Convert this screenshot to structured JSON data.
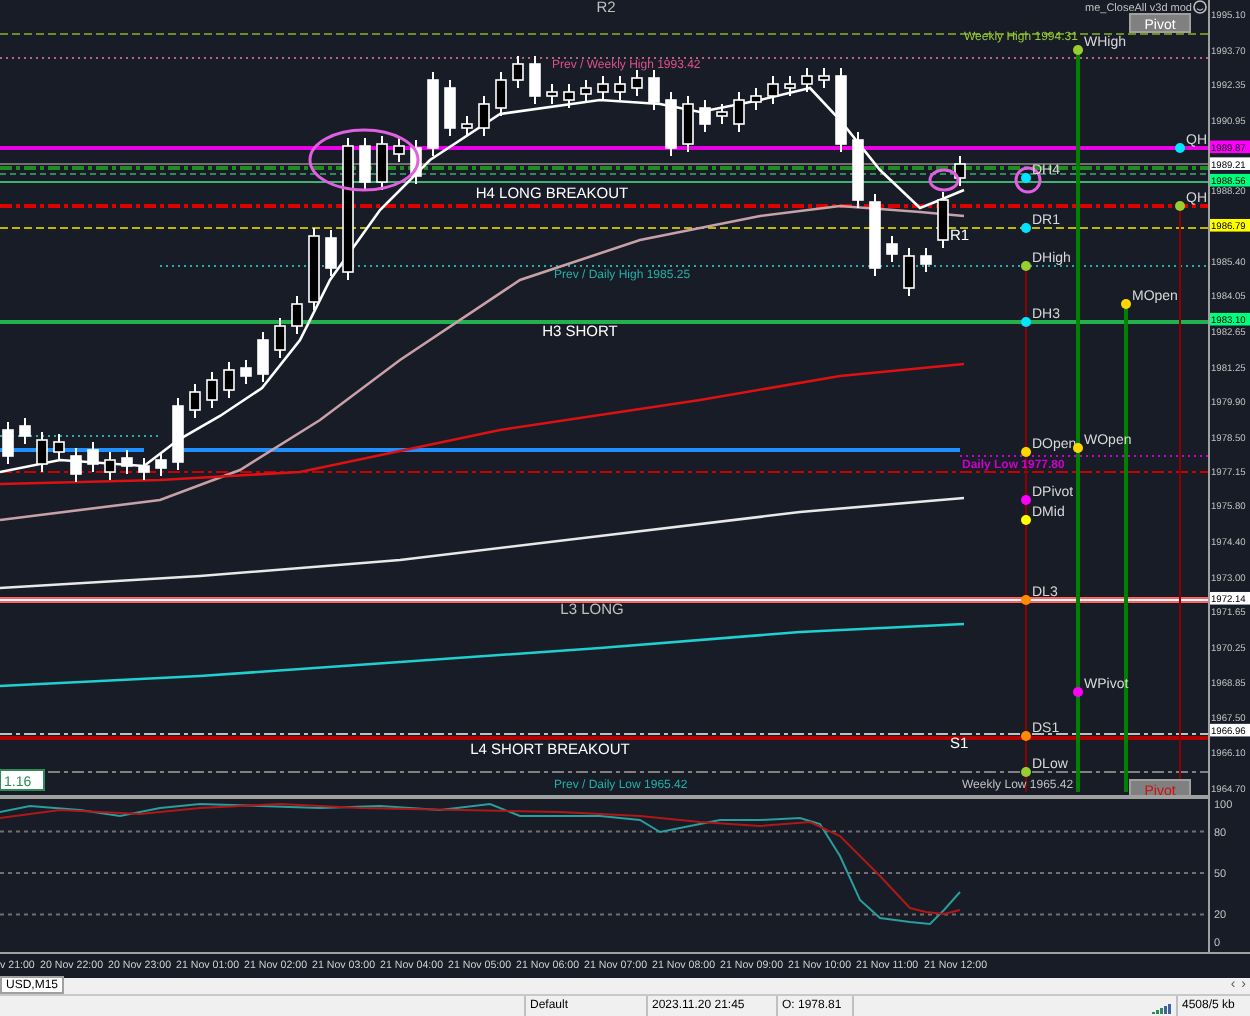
{
  "chart": {
    "expert_label": "me_CloseAll v3d  mod",
    "pivot_buttons": [
      "Pivot",
      "Pivot"
    ],
    "price_ticks": [
      "1995.10",
      "1993.70",
      "1992.35",
      "1990.95",
      "1988.20",
      "1985.40",
      "1984.05",
      "1982.65",
      "1981.25",
      "1979.90",
      "1978.50",
      "1977.15",
      "1975.80",
      "1974.40",
      "1973.00",
      "1971.65",
      "1970.25",
      "1968.85",
      "1967.50",
      "1966.10",
      "1964.70"
    ],
    "price_markers": [
      {
        "label": "1989.87",
        "color": "#ff00ff"
      },
      {
        "label": "1989.21",
        "color": "#ffffff"
      },
      {
        "label": "1988.56",
        "color": "#00ff7f"
      },
      {
        "label": "1986.79",
        "color": "#ffff00"
      },
      {
        "label": "1983.10",
        "color": "#00ff7f"
      },
      {
        "label": "1972.14",
        "color": "#ffffff"
      },
      {
        "label": "1966.96",
        "color": "#ffffff"
      }
    ],
    "level_labels": [
      {
        "text": "R2",
        "color": "#c0c0c0"
      },
      {
        "text": "Weekly High 1994.31",
        "color": "#9acd32"
      },
      {
        "text": "Prev / Weekly High 1993.42",
        "color": "#e0508a"
      },
      {
        "text": "H4 LONG BREAKOUT",
        "color": "#ffffff"
      },
      {
        "text": "R1",
        "color": "#ffffff"
      },
      {
        "text": "Prev / Daily High 1985.25",
        "color": "#20b2aa"
      },
      {
        "text": "H3 SHORT",
        "color": "#ffffff"
      },
      {
        "text": "Daily Low 1977.80",
        "color": "#cc00cc"
      },
      {
        "text": "L3 LONG",
        "color": "#c0c0c0"
      },
      {
        "text": "L4 SHORT BREAKOUT",
        "color": "#ffffff"
      },
      {
        "text": "S1",
        "color": "#ffffff"
      },
      {
        "text": "Prev / Daily Low 1965.42",
        "color": "#20b2aa"
      },
      {
        "text": "Weekly Low 1965.42",
        "color": "#c0c0c0"
      }
    ],
    "point_labels": [
      {
        "label": "WHigh",
        "color": "#9acd32"
      },
      {
        "label": "QH",
        "color": "#00e5ff"
      },
      {
        "label": "DH4",
        "color": "#00e5ff"
      },
      {
        "label": "QH",
        "color": "#9acd32"
      },
      {
        "label": "DR1",
        "color": "#00e5ff"
      },
      {
        "label": "DHigh",
        "color": "#9acd32"
      },
      {
        "label": "MOpen",
        "color": "#ffd700"
      },
      {
        "label": "DH3",
        "color": "#00e5ff"
      },
      {
        "label": "DOpen",
        "color": "#ffd700"
      },
      {
        "label": "WOpen",
        "color": "#ffd700"
      },
      {
        "label": "DPivot",
        "color": "#ff00ff"
      },
      {
        "label": "DMid",
        "color": "#ffff00"
      },
      {
        "label": "DL3",
        "color": "#ff8c00"
      },
      {
        "label": "WPivot",
        "color": "#ff00ff"
      },
      {
        "label": "DS1",
        "color": "#ff8c00"
      },
      {
        "label": "DLow",
        "color": "#9acd32"
      }
    ],
    "left_badge": "1.16"
  },
  "oscillator": {
    "ticks": [
      "100",
      "80",
      "50",
      "20",
      "0"
    ]
  },
  "time_axis": [
    "v 21:00",
    "20 Nov 22:00",
    "20 Nov 23:00",
    "21 Nov 01:00",
    "21 Nov 02:00",
    "21 Nov 03:00",
    "21 Nov 04:00",
    "21 Nov 05:00",
    "21 Nov 06:00",
    "21 Nov 07:00",
    "21 Nov 08:00",
    "21 Nov 09:00",
    "21 Nov 10:00",
    "21 Nov 11:00",
    "21 Nov 12:00"
  ],
  "tab_bar": {
    "tab": "USD,M15",
    "arrows": [
      "‹",
      "›"
    ]
  },
  "status_bar": [
    "Default",
    "2023.11.20 21:45",
    "O: 1978.81",
    "4508/5 kb"
  ]
}
